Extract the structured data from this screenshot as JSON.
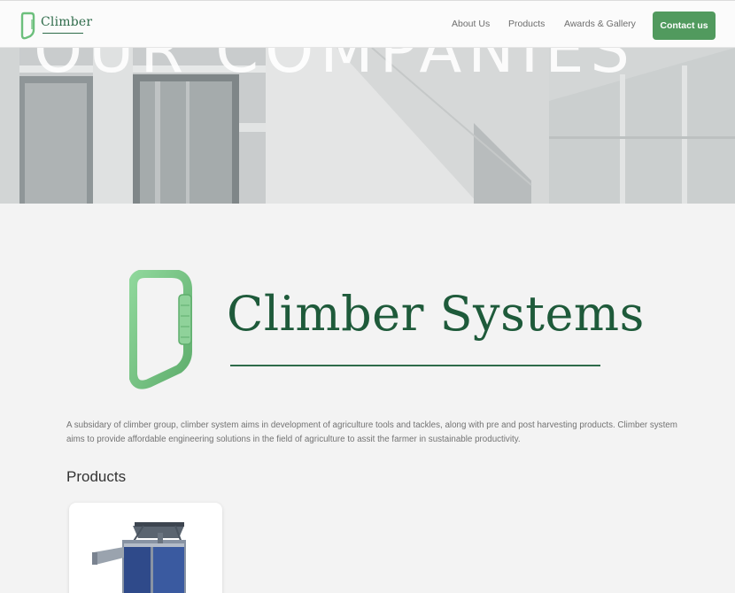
{
  "header": {
    "logo_text": "Climber",
    "nav": {
      "about": "About Us",
      "products": "Products",
      "awards": "Awards & Gallery"
    },
    "contact_label": "Contact us"
  },
  "hero": {
    "heading": "OUR COMPANIES"
  },
  "company": {
    "name": "Climber Systems",
    "description": "A subsidary of climber group, climber system aims in development of agriculture tools and tackles, along with pre and post harvesting products. Climber system aims to provide affordable engineering solutions in the field of agriculture to assit the farmer in sustainable productivity."
  },
  "products": {
    "heading": "Products"
  },
  "colors": {
    "accent": "#519a5e",
    "brand_text": "#1e5a3a",
    "carabiner": "#7cc98a"
  }
}
